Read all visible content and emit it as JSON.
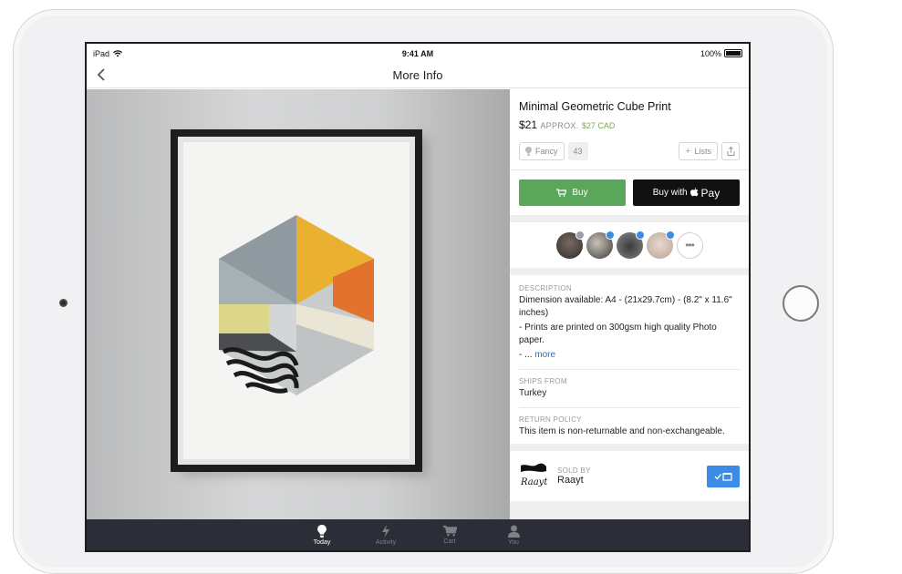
{
  "status": {
    "carrier": "iPad",
    "time": "9:41 AM",
    "battery": "100%"
  },
  "nav": {
    "title": "More Info"
  },
  "product": {
    "title": "Minimal Geometric Cube Print",
    "price": "$21",
    "approx": "APPROX.",
    "cad": "$27 CAD",
    "fancy_label": "Fancy",
    "fancy_count": "43",
    "lists_label": "Lists",
    "buy_label": "Buy",
    "applepay_prefix": "Buy with",
    "applepay_suffix": "Pay"
  },
  "details": {
    "description_label": "DESCRIPTION",
    "description_line1": "Dimension available: A4 - (21x29.7cm) - (8.2\" x 11.6\" inches)",
    "description_line2": "- Prints are printed on 300gsm high quality Photo paper.",
    "description_line3": "- ...",
    "more_label": "more",
    "ships_label": "SHIPS FROM",
    "ships_value": "Turkey",
    "return_label": "RETURN POLICY",
    "return_value": "This item is non-returnable and non-exchangeable."
  },
  "seller": {
    "sold_by_label": "SOLD BY",
    "name": "Raayt",
    "logo_text": "Raayt"
  },
  "tabs": [
    {
      "label": "Today",
      "icon": "bulb-icon"
    },
    {
      "label": "Activity",
      "icon": "lightning-icon"
    },
    {
      "label": "Cart",
      "icon": "cart-icon"
    },
    {
      "label": "You",
      "icon": "person-icon"
    }
  ],
  "colors": {
    "buy": "#5aa75c",
    "accent": "#3c8ce6",
    "tabbar": "#2b2e36",
    "cad": "#7fa856"
  }
}
